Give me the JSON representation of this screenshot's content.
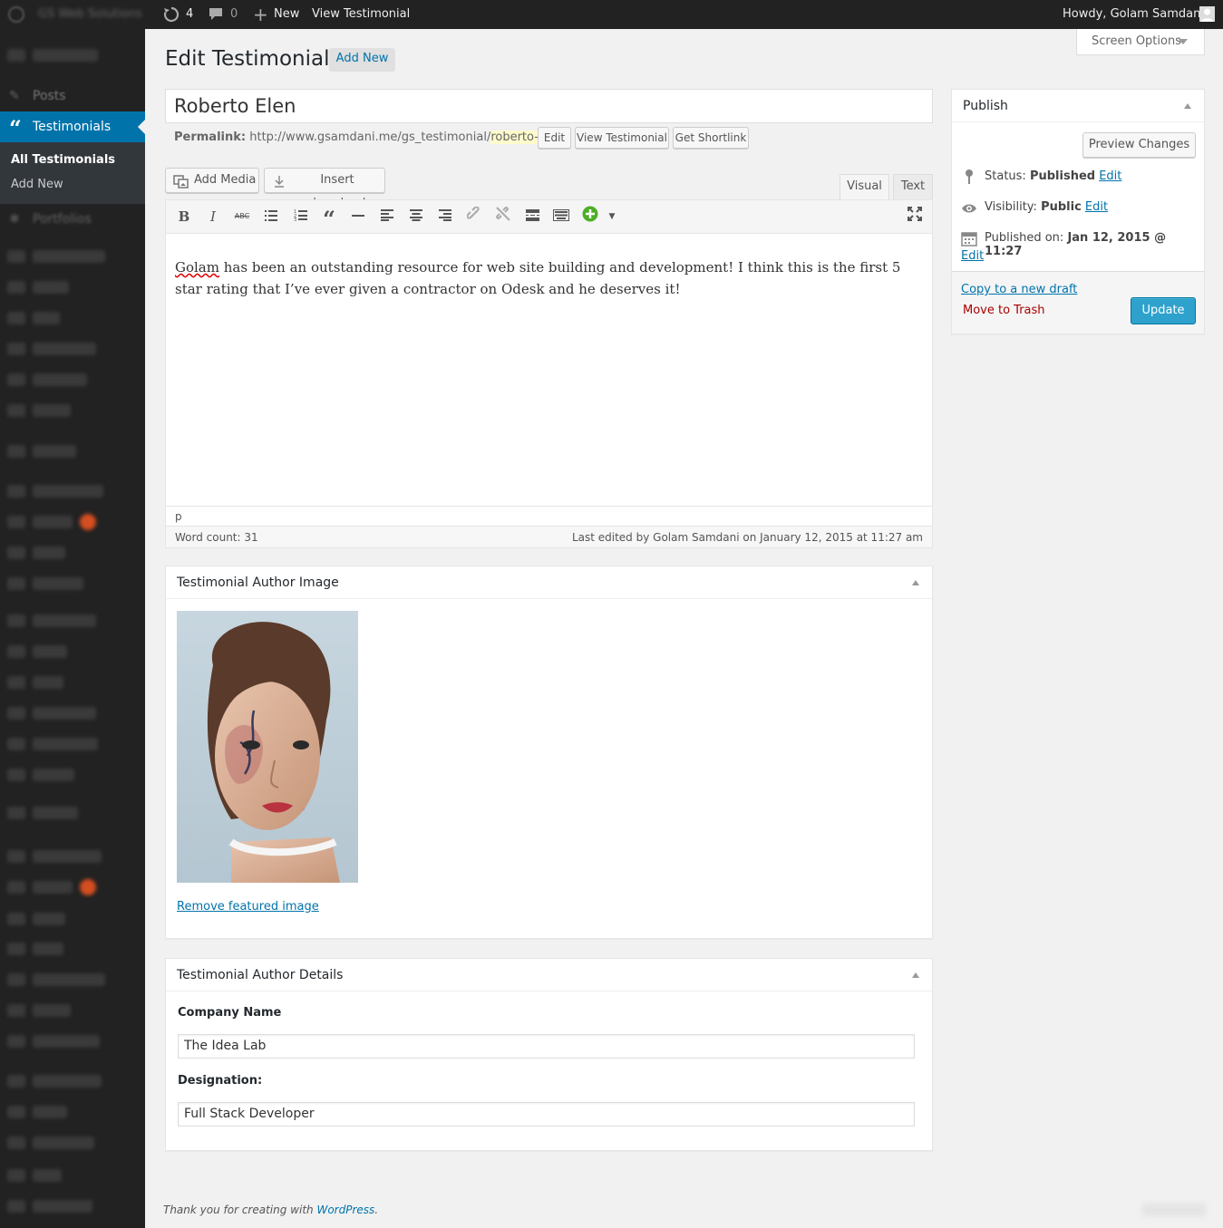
{
  "adminbar": {
    "site_name": "GS Web Solutions",
    "updates_count": "4",
    "comments_count": "0",
    "new_label": "New",
    "view_label": "View Testimonial",
    "howdy": "Howdy, Golam Samdani"
  },
  "sidebar": {
    "posts_label": "Posts",
    "testimonials_label": "Testimonials",
    "all_testimonials": "All Testimonials",
    "add_new": "Add New",
    "portfolios_label": "Portfolios"
  },
  "header": {
    "title": "Edit Testimonial",
    "add_new": "Add New",
    "screen_options": "Screen Options"
  },
  "post": {
    "title": "Roberto Elen",
    "permalink_label": "Permalink:",
    "permalink_base": "http://www.gsamdani.me/gs_testimonial/",
    "permalink_slug": "roberto-elen",
    "edit_btn": "Edit",
    "view_btn": "View Testimonial",
    "shortlink_btn": "Get Shortlink"
  },
  "editor": {
    "add_media": "Add Media",
    "insert_download": "Insert download",
    "tab_visual": "Visual",
    "tab_text": "Text",
    "content_first_word": "Golam",
    "content_rest": " has been an outstanding resource for web site building and development!  I think this is the first 5 star rating that I’ve ever given a contractor on Odesk and he deserves it!",
    "path": "p",
    "word_count": "Word count: 31",
    "last_edited": "Last edited by Golam Samdani on January 12, 2015 at 11:27 am"
  },
  "author_image": {
    "heading": "Testimonial Author Image",
    "remove_link": "Remove featured image"
  },
  "author_details": {
    "heading": "Testimonial Author Details",
    "company_label": "Company Name",
    "company_value": "The Idea Lab",
    "designation_label": "Designation:",
    "designation_value": "Full Stack Developer"
  },
  "publish": {
    "heading": "Publish",
    "preview": "Preview Changes",
    "status_label": "Status:",
    "status_value": "Published",
    "visibility_label": "Visibility:",
    "visibility_value": "Public",
    "published_label": "Published on:",
    "published_value": "Jan 12, 2015 @ 11:27",
    "edit": "Edit",
    "copy_draft": "Copy to a new draft",
    "trash": "Move to Trash",
    "update": "Update"
  },
  "footer": {
    "thanks": "Thank you for creating with ",
    "wordpress": "WordPress",
    "period": "."
  },
  "colors": {
    "accent": "#0073aa",
    "update_button": "#2ea2cc",
    "admin_bar": "#222222",
    "trash": "#a00000"
  }
}
